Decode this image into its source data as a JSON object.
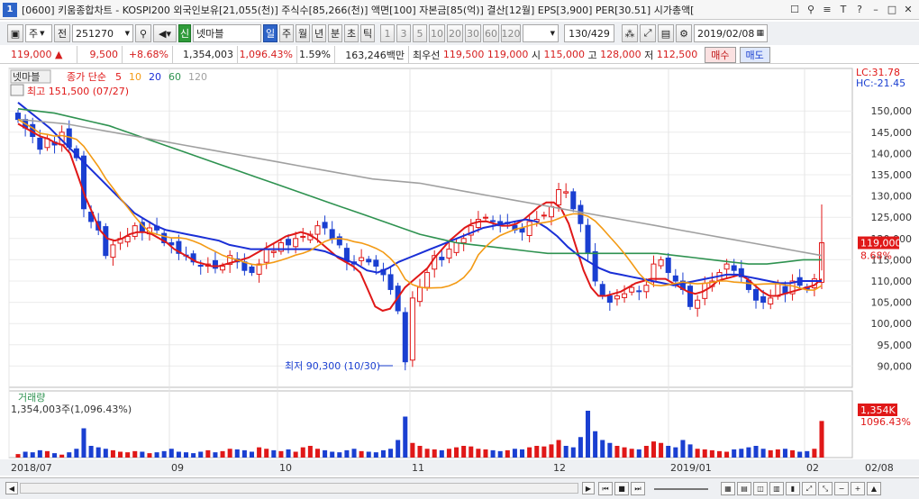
{
  "window": {
    "number": "1",
    "title": "[0600] 키움종합차트 - KOSPI200 외국인보유[21,055(천)] 주식수[85,266(천)] 액면[100] 자본금[85(억)] 결산[12월] EPS[3,900] PER[30.51] 시가총액[",
    "icons": [
      "layout-icon",
      "pin-icon",
      "help-icon",
      "font-icon",
      "minimize-icon",
      "maximize-icon",
      "close-icon"
    ],
    "icon_glyphs": [
      "☐",
      "⚲",
      "?",
      "T",
      "?",
      "–",
      "□",
      "✕"
    ]
  },
  "toolbar": {
    "market": "주",
    "market_type": "전",
    "code": "251270",
    "name": "넷마블",
    "periods": [
      "일",
      "주",
      "월",
      "년",
      "분",
      "초",
      "틱"
    ],
    "active_period": "일",
    "intervals": [
      "1",
      "3",
      "5",
      "10",
      "20",
      "30",
      "60",
      "120"
    ],
    "count": "130/429",
    "date": "2019/02/08"
  },
  "quote": {
    "price": "119,000",
    "change": "9,500",
    "change_pct": "+8.68%",
    "volume": "1,354,003",
    "volume_pct": "1,096.43%",
    "turnover": "1.59%",
    "amount": "163,246백만",
    "best_ask_label": "최우선",
    "best_ask": "119,500",
    "best_bid": "119,000",
    "open_label": "시",
    "open": "115,000",
    "high_label": "고",
    "high": "128,000",
    "low_label": "저",
    "low": "112,500",
    "buy_label": "매수",
    "sell_label": "매도"
  },
  "chart_data": {
    "type": "candlestick",
    "stock": "넷마블",
    "legend": {
      "title": "종가 단순",
      "ma": [
        {
          "period": "5",
          "color": "#e01818"
        },
        {
          "period": "10",
          "color": "#f39a14"
        },
        {
          "period": "20",
          "color": "#1a2fd6"
        },
        {
          "period": "60",
          "color": "#2e9250"
        },
        {
          "period": "120",
          "color": "#a0a0a0"
        }
      ]
    },
    "ylim": [
      85000,
      160000
    ],
    "y_ticks": [
      "150,000",
      "145,000",
      "140,000",
      "135,000",
      "130,000",
      "125,000",
      "120,000",
      "115,000",
      "110,000",
      "105,000",
      "100,000",
      "95,000",
      "90,000"
    ],
    "x_ticks": [
      "2018/07",
      "09",
      "10",
      "11",
      "12",
      "2019/01",
      "02",
      "02/08"
    ],
    "annotations": {
      "high": "최고 151,500 (07/27)",
      "low": "최저 90,300 (10/30)",
      "lc": "LC:31.78",
      "hc": "HC:-21.45",
      "last_price": "119,000",
      "last_pct": "8.68%"
    },
    "closes": [
      148000,
      146000,
      144000,
      141000,
      143500,
      142000,
      145000,
      141500,
      139000,
      127000,
      124000,
      122000,
      116000,
      118500,
      120000,
      120500,
      123000,
      121500,
      122500,
      122000,
      119000,
      118500,
      116500,
      116000,
      114500,
      113500,
      114000,
      113000,
      113500,
      116000,
      114500,
      112500,
      112000,
      114000,
      117500,
      117000,
      119000,
      118500,
      120000,
      120500,
      121000,
      123000,
      122500,
      120000,
      118500,
      114500,
      114000,
      115500,
      114500,
      113500,
      111500,
      108000,
      103000,
      91000,
      106000,
      108500,
      112000,
      116000,
      115000,
      117500,
      119000,
      120000,
      123000,
      124500,
      125000,
      124000,
      123000,
      123500,
      122000,
      121500,
      124000,
      124500,
      125500,
      127500,
      131500,
      131000,
      127000,
      123500,
      116500,
      110000,
      106500,
      105000,
      106500,
      107000,
      108500,
      107500,
      109000,
      114000,
      115000,
      112000,
      110000,
      108000,
      104000,
      105500,
      109500,
      110000,
      112000,
      114000,
      112500,
      111000,
      108000,
      105500,
      105000,
      106000,
      109500,
      107000,
      110000,
      109000,
      108000,
      110500,
      119000
    ],
    "volume_label": "거래량",
    "volume_value": "1,354,003주(1,096.43%)",
    "volume_tag": "1,354K",
    "volume_tag_pct": "1096.43%",
    "volumes": [
      12,
      20,
      18,
      25,
      22,
      15,
      10,
      18,
      30,
      100,
      40,
      35,
      30,
      25,
      20,
      18,
      22,
      20,
      15,
      18,
      22,
      30,
      20,
      18,
      15,
      20,
      25,
      18,
      22,
      30,
      28,
      25,
      20,
      35,
      30,
      25,
      22,
      28,
      20,
      35,
      40,
      30,
      25,
      20,
      18,
      25,
      30,
      22,
      20,
      18,
      25,
      30,
      60,
      140,
      50,
      40,
      30,
      28,
      25,
      30,
      35,
      40,
      38,
      30,
      28,
      25,
      22,
      25,
      30,
      28,
      35,
      40,
      38,
      45,
      60,
      40,
      35,
      70,
      160,
      90,
      60,
      50,
      40,
      35,
      30,
      28,
      40,
      55,
      50,
      40,
      35,
      60,
      45,
      30,
      28,
      25,
      22,
      20,
      28,
      30,
      35,
      40,
      30,
      25,
      28,
      30,
      25,
      20,
      22,
      30,
      125
    ],
    "ma_series": {
      "ma5": [
        147000,
        146000,
        145000,
        144000,
        143500,
        142500,
        142000,
        140000,
        135000,
        130000,
        126000,
        122000,
        120000,
        119500,
        120000,
        121000,
        121500,
        121500,
        121000,
        120000,
        119000,
        117500,
        116500,
        115500,
        114500,
        114000,
        113500,
        113500,
        114000,
        114500,
        115000,
        115500,
        116500,
        117500,
        118500,
        119500,
        120500,
        121000,
        121500,
        121000,
        120000,
        118500,
        117000,
        115500,
        114500,
        113500,
        112000,
        108000,
        104000,
        103000,
        103500,
        106000,
        108500,
        110000,
        111500,
        113000,
        115500,
        117500,
        119500,
        121000,
        122500,
        123500,
        124000,
        124000,
        123500,
        123000,
        123000,
        123500,
        124500,
        126000,
        127500,
        128500,
        128500,
        127000,
        123500,
        118000,
        112500,
        108500,
        106500,
        106500,
        107000,
        107500,
        108500,
        109500,
        110000,
        110500,
        110500,
        110500,
        109500,
        108500,
        107500,
        107000,
        107500,
        108500,
        110000,
        110500,
        111000,
        111500,
        110500,
        109000,
        107500,
        106500,
        106500,
        107000,
        107500,
        108000,
        108500,
        109000,
        110500
      ],
      "ma20": [
        152000,
        150000,
        148000,
        146000,
        143500,
        141000,
        138500,
        136000,
        133500,
        131000,
        128500,
        126000,
        124500,
        123000,
        122000,
        121500,
        121000,
        120500,
        120000,
        119500,
        118500,
        118000,
        117500,
        117500,
        117500,
        117500,
        117500,
        117500,
        117500,
        117000,
        116000,
        115000,
        114000,
        112500,
        112000,
        113000,
        114500,
        115500,
        116500,
        117500,
        118500,
        119500,
        120500,
        121500,
        122500,
        123000,
        123500,
        124000,
        124500,
        124000,
        122500,
        120500,
        118000,
        116000,
        114500,
        113000,
        112000,
        111500,
        111000,
        110500,
        110000,
        109500,
        109000,
        109500,
        110000,
        110500,
        111000,
        111500,
        111500,
        111000,
        110500,
        110000,
        109500,
        109500,
        110000,
        110000,
        110000
      ],
      "ma60": [
        150500,
        150000,
        149500,
        148500,
        147500,
        146500,
        145000,
        143500,
        142000,
        140500,
        139000,
        137500,
        136000,
        134500,
        133000,
        131500,
        130000,
        128500,
        127000,
        125500,
        124000,
        122500,
        121000,
        120000,
        119000,
        118500,
        118000,
        117500,
        117000,
        116500,
        116500,
        116500,
        116500,
        116500,
        116500,
        116500,
        116000,
        115500,
        115000,
        114500,
        114000,
        114000,
        114500,
        115000,
        115000
      ],
      "ma120": [
        148000,
        147500,
        147000,
        146000,
        145000,
        144000,
        143000,
        142000,
        141000,
        140000,
        139000,
        138000,
        137000,
        136000,
        135000,
        134000,
        133500,
        133000,
        132000,
        131000,
        130000,
        129000,
        128000,
        127000,
        126000,
        125000,
        124000,
        123000,
        122000,
        121000,
        120000,
        119000,
        118000,
        117000,
        116000
      ]
    }
  }
}
